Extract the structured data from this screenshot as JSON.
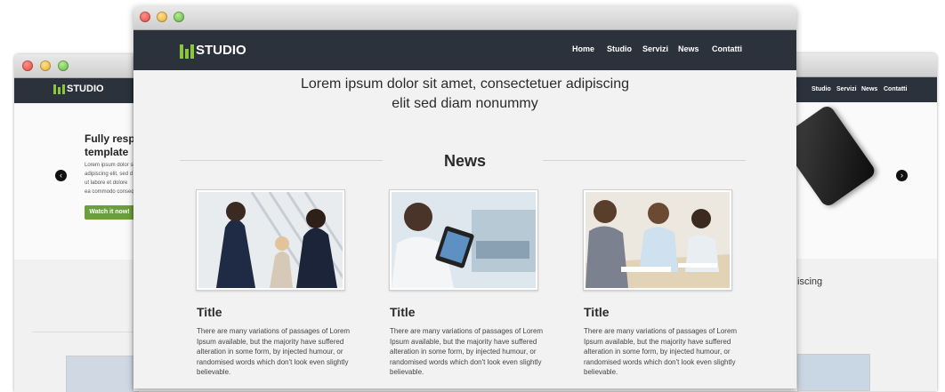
{
  "brand": {
    "name": "STUDIO"
  },
  "nav": [
    "Home",
    "Studio",
    "Servizi",
    "News",
    "Contatti"
  ],
  "left_window": {
    "hero_title": "Fully respo",
    "hero_title_2": "template",
    "hero_text": [
      "Lorem ipsum dolor si",
      "adipiscing elit, sed d",
      "ut labore et dolore",
      "ea commodo consequ"
    ],
    "cta_label": "Watch it now!"
  },
  "right_window": {
    "partial_text": "iscing"
  },
  "front_window": {
    "intro_line1": "Lorem ipsum dolor sit amet, consectetuer adipiscing",
    "intro_line2": "elit sed diam nonummy",
    "section_title": "News",
    "cards": [
      {
        "title": "Title",
        "text": "There are many variations of passages of Lorem Ipsum available, but the majority have suffered alteration in some form, by injected humour, or randomised words which don't look even slightly believable."
      },
      {
        "title": "Title",
        "text": "There are many variations of passages of Lorem Ipsum available, but the majority have suffered alteration in some form, by injected humour, or randomised words which don't look even slightly believable."
      },
      {
        "title": "Title",
        "text": "There are many variations of passages of Lorem Ipsum available, but the majority have suffered alteration in some form, by injected humour, or randomised words which don't look even slightly believable."
      }
    ]
  },
  "colors": {
    "navbar": "#2b323c",
    "logo_accent": "#8cc63f",
    "cta": "#6a9f3a"
  }
}
